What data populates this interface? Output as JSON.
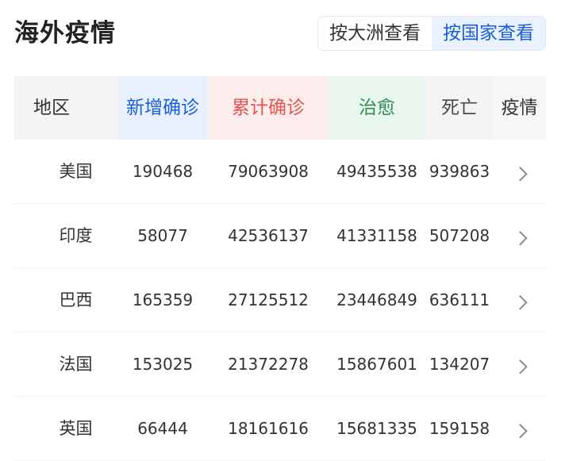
{
  "header": {
    "title": "海外疫情",
    "toggle": [
      {
        "label": "按大洲查看",
        "active": false
      },
      {
        "label": "按国家查看",
        "active": true
      }
    ]
  },
  "colors": {
    "accent": "#1a5fd6",
    "new": "#1a5fd6",
    "total": "#e55353",
    "cured": "#2e8b57",
    "death": "#4a4a4a"
  },
  "table": {
    "columns": {
      "region": "地区",
      "new": "新增确诊",
      "total": "累计确诊",
      "cured": "治愈",
      "death": "死亡",
      "detail": "疫情"
    },
    "rows": [
      {
        "region": "美国",
        "new": "190468",
        "total": "79063908",
        "cured": "49435538",
        "death": "939863",
        "icon": "chevron-right-icon"
      },
      {
        "region": "印度",
        "new": "58077",
        "total": "42536137",
        "cured": "41331158",
        "death": "507208",
        "icon": "chevron-right-icon"
      },
      {
        "region": "巴西",
        "new": "165359",
        "total": "27125512",
        "cured": "23446849",
        "death": "636111",
        "icon": "chevron-right-icon"
      },
      {
        "region": "法国",
        "new": "153025",
        "total": "21372278",
        "cured": "15867601",
        "death": "134207",
        "icon": "chevron-right-icon"
      },
      {
        "region": "英国",
        "new": "66444",
        "total": "18161616",
        "cured": "15681335",
        "death": "159158",
        "icon": "chevron-right-icon"
      }
    ]
  }
}
